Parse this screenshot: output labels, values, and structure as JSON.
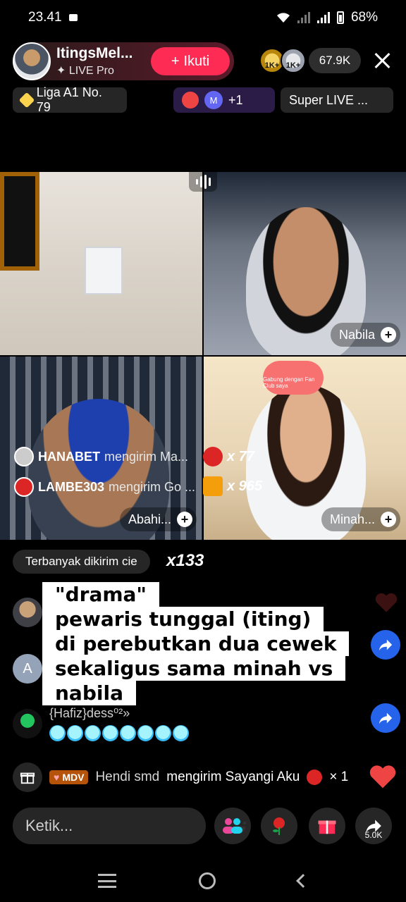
{
  "status_bar": {
    "time": "23.41",
    "battery": "68%"
  },
  "host": {
    "name": "ItingsMel...",
    "subtitle": "LIVE Pro",
    "follow_label": "Ikuti"
  },
  "viewers": {
    "badge1": "1K+",
    "badge2": "1K+",
    "count": "67.9K"
  },
  "chips": {
    "rank": "Liga A1 No. 79",
    "gifts_avatar": "M",
    "gifts_more": "+1",
    "super": "Super LIVE ..."
  },
  "tiles": [
    {
      "label": ""
    },
    {
      "label": "Nabila"
    },
    {
      "label": "Abahi..."
    },
    {
      "label": "Minah..."
    }
  ],
  "fanclub_text": "Gabung dengan Fan Club saya",
  "gift_notifications": [
    {
      "name": "HANABET",
      "message": "mengirim Ma...",
      "count": "x 77"
    },
    {
      "name": "LAMBE303",
      "message": "mengirim Go ...",
      "count": "x 965"
    }
  ],
  "top_sent": {
    "label": "Terbanyak dikirim cie",
    "count": "x133"
  },
  "overlay_lines": [
    "\"drama\"",
    "pewaris tunggal (iting)",
    "di perebutkan dua cewek",
    "sekaligus sama minah vs",
    "nabila"
  ],
  "comments": [
    {
      "avatar_letter": "A"
    },
    {
      "name": "{Hafiz}dess⁰²»",
      "emoji_count": 8
    }
  ],
  "ticker": {
    "badge": "MDV",
    "sender": "Hendi smd",
    "message": "mengirim Sayangi Aku",
    "count": "× 1"
  },
  "input": {
    "placeholder": "Ketik..."
  },
  "share_count": "5.0K",
  "colors": {
    "accent": "#fe2c55",
    "share_blue": "#2563eb"
  }
}
